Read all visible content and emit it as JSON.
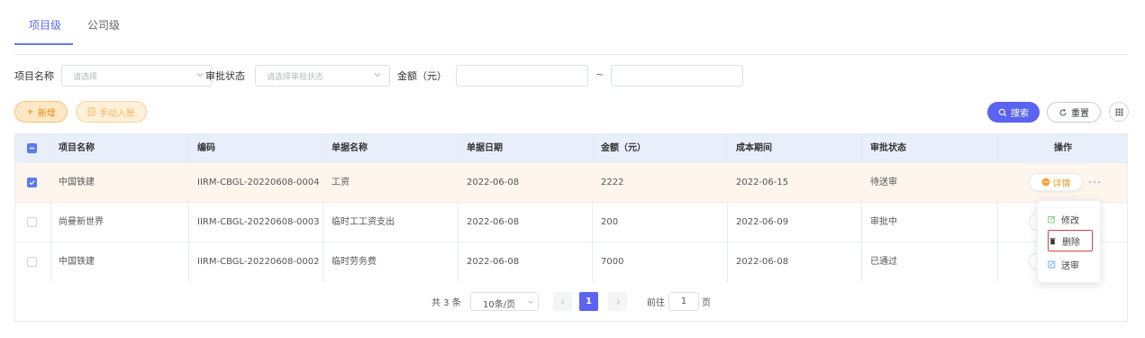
{
  "tabs": [
    {
      "label": "项目级",
      "active": true
    },
    {
      "label": "公司级",
      "active": false
    }
  ],
  "filters": {
    "project_label": "项目名称",
    "project_placeholder": "请选择",
    "status_label": "审批状态",
    "status_placeholder": "请选择审批状态",
    "amount_label": "金额（元）",
    "range_sep": "~"
  },
  "actions": {
    "add_label": "新增",
    "manual_label": "手动入账",
    "search_label": "搜索",
    "reset_label": "重置"
  },
  "table": {
    "columns": [
      "项目名称",
      "编码",
      "单据名称",
      "单据日期",
      "金额（元）",
      "成本期间",
      "审批状态",
      "操作"
    ],
    "rows": [
      {
        "project": "中国铁建",
        "code": "IIRM-CBGL-20220608-0004",
        "doc": "工资",
        "date": "2022-06-08",
        "amount": "2222",
        "period": "2022-06-15",
        "status": "待送审",
        "checked": true
      },
      {
        "project": "尚曼新世界",
        "code": "IIRM-CBGL-20220608-0003",
        "doc": "临时工工资支出",
        "date": "2022-06-08",
        "amount": "200",
        "period": "2022-06-09",
        "status": "审批中",
        "checked": false
      },
      {
        "project": "中国铁建",
        "code": "IIRM-CBGL-20220608-0002",
        "doc": "临时劳务费",
        "date": "2022-06-08",
        "amount": "7000",
        "period": "2022-06-08",
        "status": "已通过",
        "checked": false
      }
    ],
    "detail_label": "详情"
  },
  "pagination": {
    "total": "共 3 条",
    "page_size": "10条/页",
    "current": "1",
    "goto_label": "前往",
    "goto_value": "1",
    "page_suffix": "页"
  },
  "row_menu": {
    "items": [
      "修改",
      "删除",
      "送审"
    ],
    "highlighted": "删除"
  },
  "colors": {
    "primary": "#5b63f2",
    "accent_orange": "#e89a2b",
    "selected_row": "#fef5ec",
    "header_bg": "#e9eefb"
  }
}
